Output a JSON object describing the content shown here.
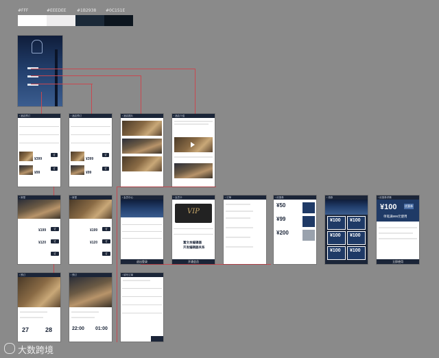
{
  "palette": [
    {
      "label": "#FFF",
      "color": "#ffffff"
    },
    {
      "label": "#EEEDEE",
      "color": "#eeedee"
    },
    {
      "label": "#1B2938",
      "color": "#1b2938"
    },
    {
      "label": "#0C151E",
      "color": "#0c151e"
    }
  ],
  "prices": [
    "¥399",
    "¥99",
    "¥199",
    "¥120",
    "¥50",
    "¥99",
    "¥200"
  ],
  "coupon_values": [
    "¥100",
    "¥100",
    "¥100",
    "¥100",
    "¥100",
    "¥100"
  ],
  "promo": {
    "value": "¥100",
    "tag": "优惠券",
    "sub": "单笔满999元使用"
  },
  "vip": {
    "card": "VIP",
    "text1": "富文本编辑器",
    "text2": "开发编辑器关系"
  },
  "times": {
    "day1": "27",
    "day2": "28",
    "t1": "22:00",
    "t2": "01:00"
  },
  "watermark": "大数跨境",
  "icons": {
    "logo": "hotel-logo-icon",
    "play": "play-icon",
    "edit": "pencil-icon"
  }
}
